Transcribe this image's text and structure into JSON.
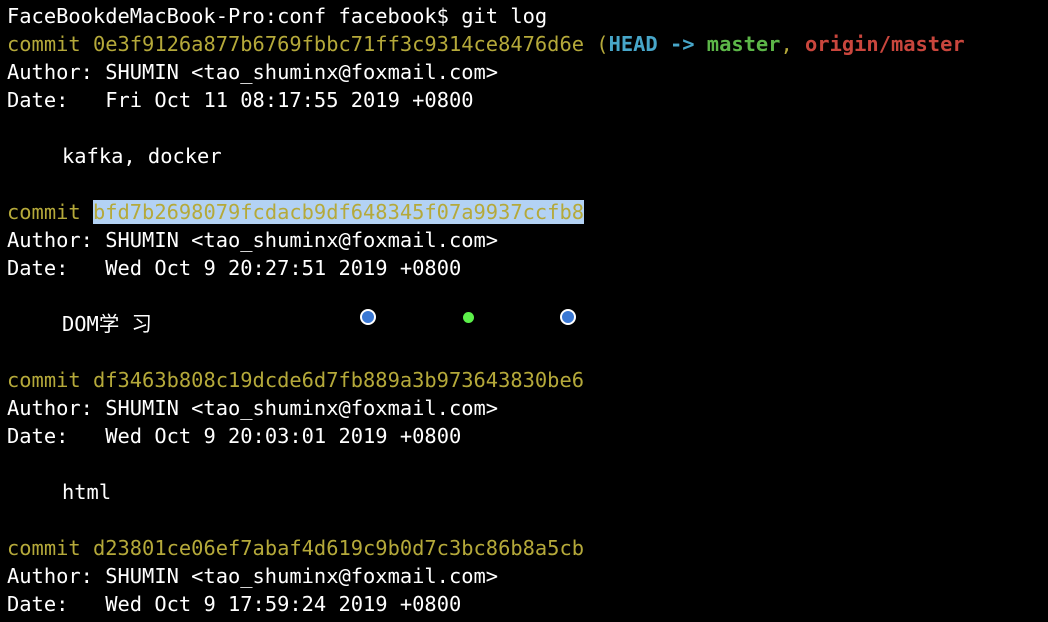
{
  "prompt": {
    "host": "FaceBookdeMacBook-Pro:conf facebook$",
    "command": "git log"
  },
  "colors": {
    "commit_hash": "#b5a93a",
    "head": "#47a6c9",
    "branch": "#5cb648",
    "remote": "#c9463d",
    "selection": "#b3d2f4"
  },
  "commits": [
    {
      "label": "commit",
      "hash": "0e3f9126a877b6769fbbc71ff3c9314ce8476d6e",
      "refs_open": "(",
      "head": "HEAD -> ",
      "branch": "master",
      "sep": ", ",
      "remote": "origin/master",
      "author_label": "Author:",
      "author": "SHUMIN <tao_shuminx@foxmail.com>",
      "date_label": "Date:",
      "date": "Fri Oct 11 08:17:55 2019 +0800",
      "message": "kafka, docker"
    },
    {
      "label": "commit",
      "hash": "bfd7b2698079fcdacb9df648345f07a9937ccfb8",
      "author_label": "Author:",
      "author": "SHUMIN <tao_shuminx@foxmail.com>",
      "date_label": "Date:",
      "date": "Wed Oct 9 20:27:51 2019 +0800",
      "message": "DOM学 习"
    },
    {
      "label": "commit",
      "hash": "df3463b808c19dcde6d7fb889a3b973643830be6",
      "author_label": "Author:",
      "author": "SHUMIN <tao_shuminx@foxmail.com>",
      "date_label": "Date:",
      "date": "Wed Oct 9 20:03:01 2019 +0800",
      "message": "html"
    },
    {
      "label": "commit",
      "hash": "d23801ce06ef7abaf4d619c9b0d7c3bc86b8a5cb",
      "author_label": "Author:",
      "author": "SHUMIN <tao_shuminx@foxmail.com>",
      "date_label": "Date:",
      "date": "Wed Oct 9 17:59:24 2019 +0800"
    }
  ]
}
